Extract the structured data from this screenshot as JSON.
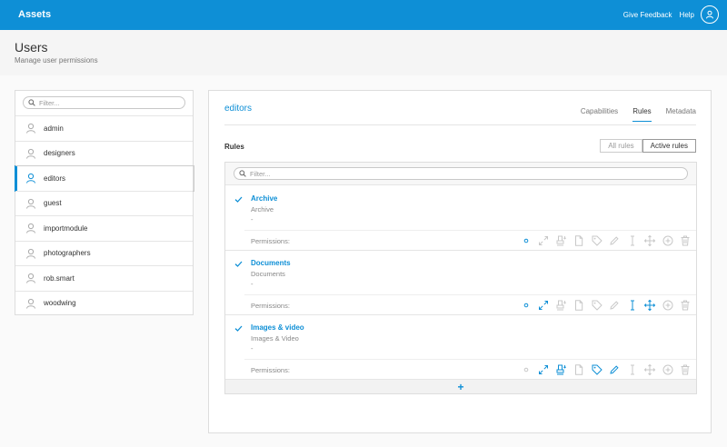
{
  "topbar": {
    "brand": "Assets",
    "links": [
      "Give Feedback",
      "Help"
    ]
  },
  "header": {
    "title": "Users",
    "subtitle": "Manage user permissions"
  },
  "sidebar": {
    "filter_placeholder": "Filter...",
    "users": [
      "admin",
      "designers",
      "editors",
      "guest",
      "importmodule",
      "photographers",
      "rob.smart",
      "woodwing"
    ],
    "active_user": "editors"
  },
  "main": {
    "group_title": "editors",
    "tabs": [
      "Capabilities",
      "Rules",
      "Metadata"
    ],
    "active_tab": "Rules",
    "rules_label": "Rules",
    "toggle": [
      "All rules",
      "Active rules"
    ],
    "toggle_active": "Active rules",
    "rules_filter_placeholder": "Filter...",
    "permissions_label": "Permissions:",
    "rules": [
      {
        "name": "Archive",
        "subtitle": "Archive",
        "dash": "-",
        "active_permissions": [
          "view"
        ]
      },
      {
        "name": "Documents",
        "subtitle": "Documents",
        "dash": "-",
        "active_permissions": [
          "view",
          "preview",
          "rename",
          "move"
        ]
      },
      {
        "name": "Images & video",
        "subtitle": "Images & Video",
        "dash": "-",
        "active_permissions": [
          "preview",
          "download",
          "metadata",
          "tag"
        ]
      }
    ],
    "add_label": "+"
  },
  "colors": {
    "accent": "#0e8fd6",
    "inactive_icon": "#c8c8c8"
  }
}
